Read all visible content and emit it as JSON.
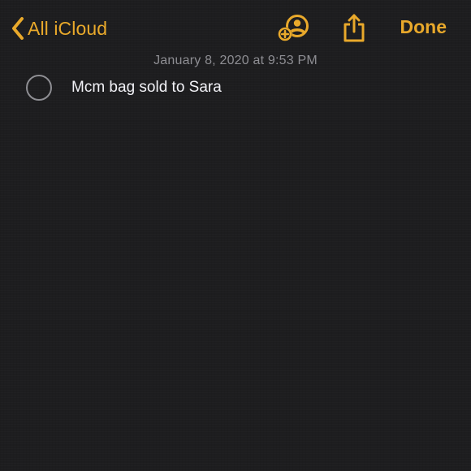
{
  "nav": {
    "back_label": "All iCloud",
    "done_label": "Done",
    "icons": {
      "back": "chevron-left-icon",
      "collaborate": "add-person-icon",
      "share": "share-icon"
    }
  },
  "note": {
    "timestamp": "January 8, 2020 at 9:53 PM",
    "checklist": [
      {
        "text": "Mcm bag sold to Sara",
        "checked": false
      }
    ]
  },
  "colors": {
    "accent": "#e9a92b",
    "background": "#1d1d1f",
    "text": "#f2f2f7",
    "secondary_text": "#8e8e93"
  }
}
